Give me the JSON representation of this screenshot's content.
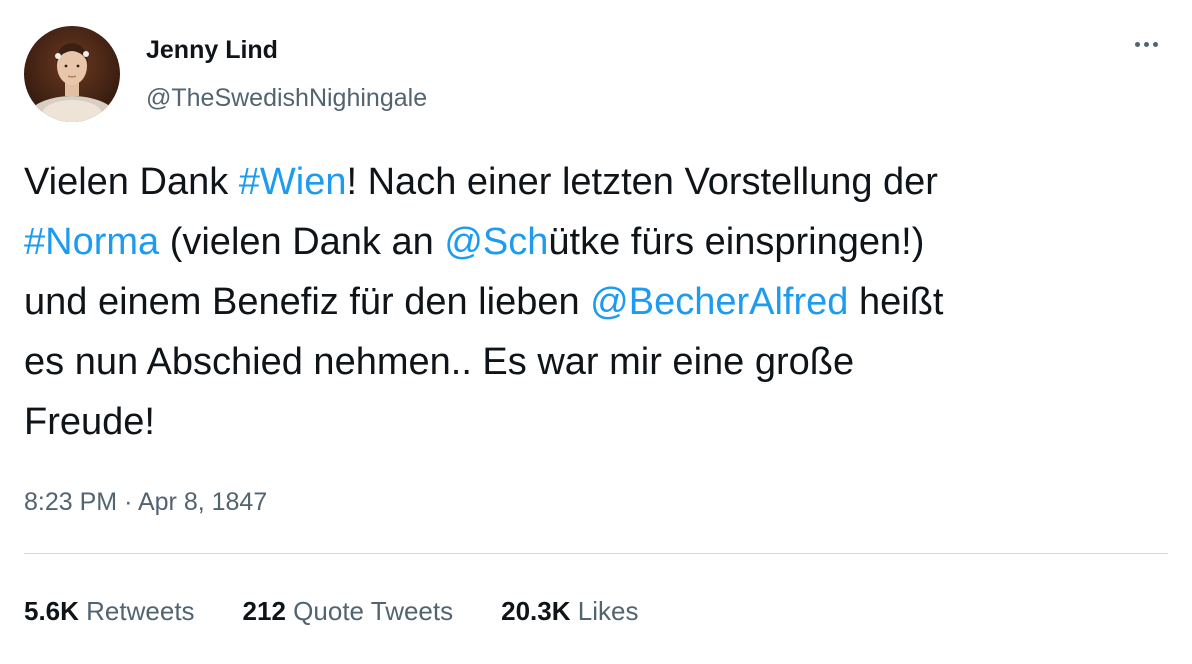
{
  "author": {
    "name": "Jenny Lind",
    "handle": "@TheSwedishNighingale"
  },
  "tweet": {
    "lines": [
      [
        {
          "text": "Vielen Dank ",
          "type": "text"
        },
        {
          "text": "#Wien",
          "type": "hashtag"
        },
        {
          "text": "! Nach einer letzten Vorstellung der",
          "type": "text"
        }
      ],
      [
        {
          "text": "#Norma",
          "type": "hashtag"
        },
        {
          "text": " (vielen Dank an ",
          "type": "text"
        },
        {
          "text": "@Sch",
          "type": "mention"
        },
        {
          "text": "ütke fürs einspringen!)",
          "type": "text"
        }
      ],
      [
        {
          "text": "und einem Benefiz für den lieben ",
          "type": "text"
        },
        {
          "text": "@BecherAlfred",
          "type": "mention"
        },
        {
          "text": " heißt",
          "type": "text"
        }
      ],
      [
        {
          "text": "es nun Abschied nehmen.. Es war mir eine große",
          "type": "text"
        }
      ],
      [
        {
          "text": "Freude!",
          "type": "text"
        }
      ]
    ]
  },
  "meta": {
    "time": "8:23 PM",
    "separator": "·",
    "date": "Apr 8, 1847"
  },
  "stats": {
    "retweets": {
      "value": "5.6K",
      "label": "Retweets"
    },
    "quotes": {
      "value": "212",
      "label": "Quote Tweets"
    },
    "likes": {
      "value": "20.3K",
      "label": "Likes"
    }
  },
  "icons": {
    "avatar": "portrait-avatar",
    "more": "more-options-icon"
  },
  "colors": {
    "link": "#1d9bf0",
    "secondary_text": "#536471",
    "primary_text": "#0f1419",
    "divider": "#cfd9de"
  }
}
